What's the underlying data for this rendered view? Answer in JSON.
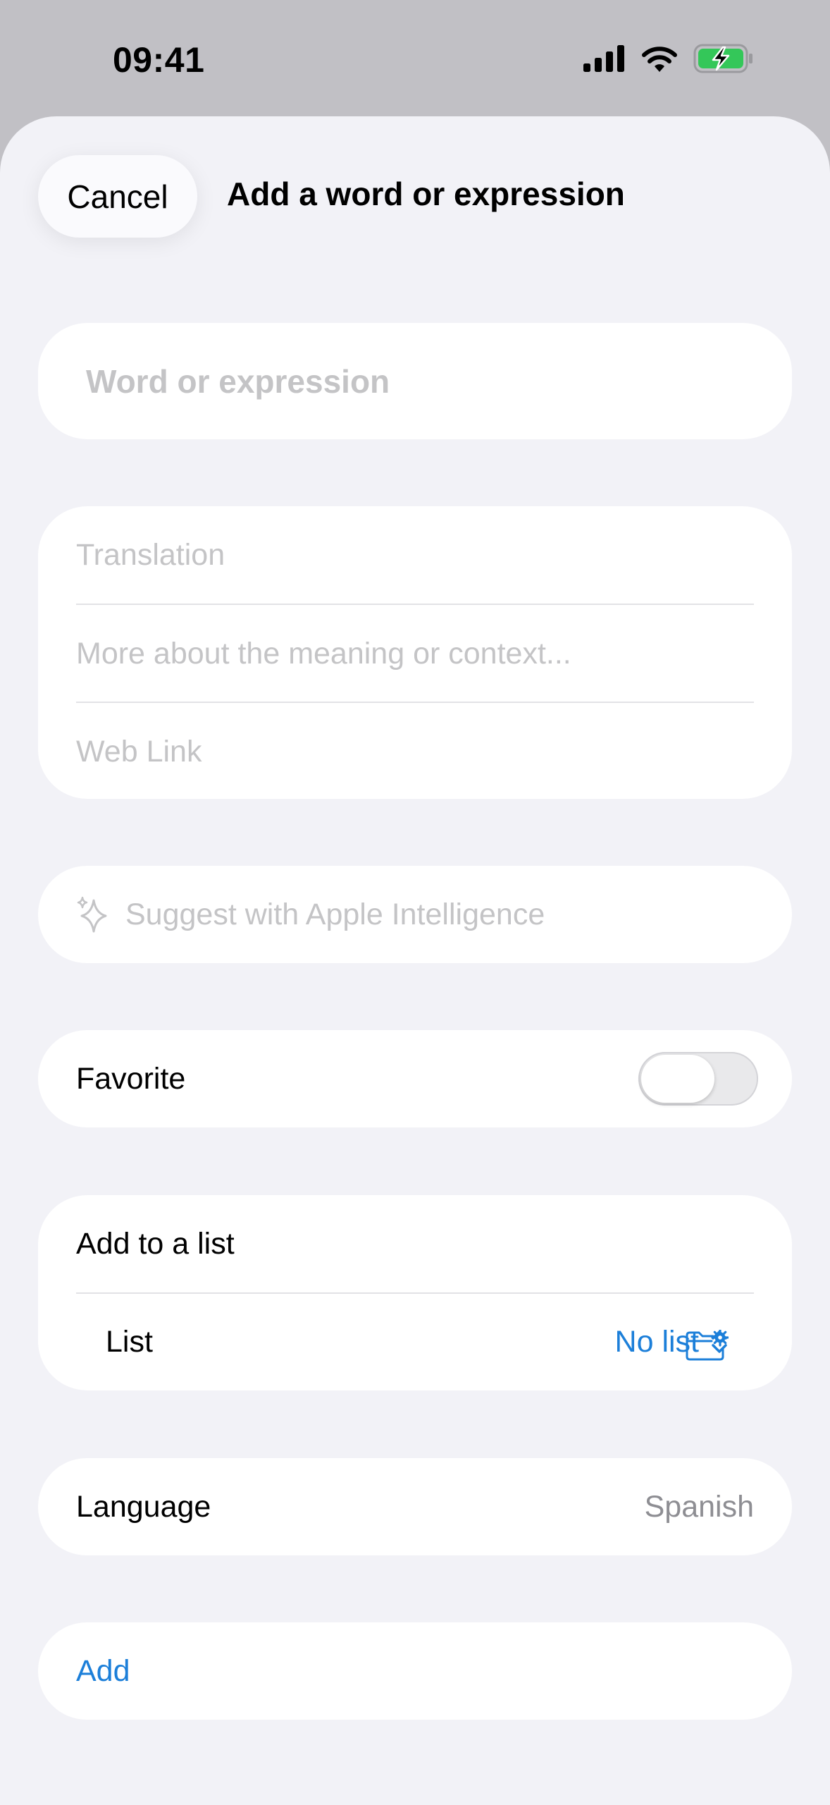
{
  "status_bar": {
    "time": "09:41"
  },
  "header": {
    "cancel_label": "Cancel",
    "title": "Add a word or expression"
  },
  "word": {
    "placeholder": "Word or expression",
    "value": ""
  },
  "details": {
    "translation_placeholder": "Translation",
    "meaning_placeholder": "More about the meaning or context...",
    "weblink_placeholder": "Web Link"
  },
  "suggest": {
    "icon": "sparkles-icon",
    "label": "Suggest with Apple Intelligence"
  },
  "favorite": {
    "label": "Favorite",
    "on": false
  },
  "list_section": {
    "header": "Add to a list",
    "list_label": "List",
    "list_value": "No list"
  },
  "language": {
    "label": "Language",
    "value": "Spanish"
  },
  "add": {
    "label": "Add"
  },
  "colors": {
    "accent": "#1c7fd9",
    "background": "#f2f2f7",
    "placeholder": "#c4c4c6",
    "secondary_text": "#8e8e93",
    "battery_fill": "#34c759"
  }
}
